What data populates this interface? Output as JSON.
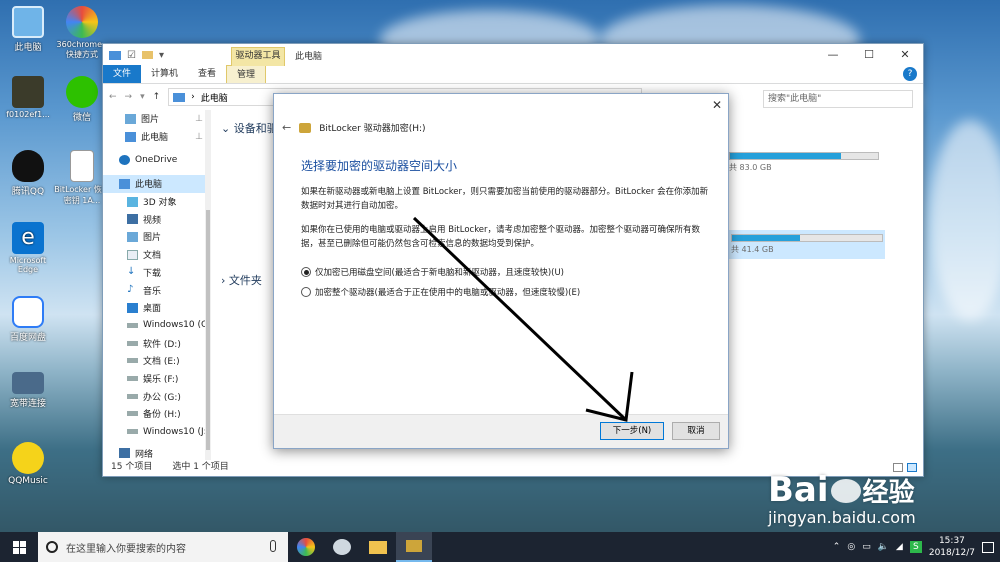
{
  "desktop_icons": [
    {
      "label": "此电脑"
    },
    {
      "label": "360chrome - 快捷方式"
    },
    {
      "label": "f0102ef1..."
    },
    {
      "label": "微信"
    },
    {
      "label": "腾讯QQ"
    },
    {
      "label": "BitLocker 恢复密钥 1A..."
    },
    {
      "label": "Microsoft Edge"
    },
    {
      "label": "百度网盘"
    },
    {
      "label": "宽带连接"
    },
    {
      "label": "QQMusic"
    }
  ],
  "explorer": {
    "context_tab_group": "驱动器工具",
    "window_title": "此电脑",
    "controls": {
      "minimize": "—",
      "maximize": "☐",
      "close": "✕"
    },
    "ribbon_tabs": [
      "文件",
      "计算机",
      "查看",
      "管理"
    ],
    "address": "此电脑",
    "search_placeholder": "搜索\"此电脑\"",
    "nav_items": [
      {
        "label": "图片",
        "icon": "pictures-icon"
      },
      {
        "label": "此电脑",
        "icon": "computer-icon"
      },
      {
        "label": "OneDrive",
        "icon": "onedrive-icon"
      },
      {
        "label": "此电脑",
        "icon": "computer-icon"
      },
      {
        "label": "3D 对象",
        "icon": "3d-objects-icon"
      },
      {
        "label": "视频",
        "icon": "video-icon"
      },
      {
        "label": "图片",
        "icon": "pictures-icon"
      },
      {
        "label": "文档",
        "icon": "documents-icon"
      },
      {
        "label": "下载",
        "icon": "download-icon"
      },
      {
        "label": "音乐",
        "icon": "music-icon"
      },
      {
        "label": "桌面",
        "icon": "desktop-icon"
      },
      {
        "label": "Windows10 (C:",
        "icon": "drive-icon"
      },
      {
        "label": "软件 (D:)",
        "icon": "drive-icon"
      },
      {
        "label": "文档 (E:)",
        "icon": "drive-icon"
      },
      {
        "label": "娱乐 (F:)",
        "icon": "drive-icon"
      },
      {
        "label": "办公 (G:)",
        "icon": "drive-icon"
      },
      {
        "label": "备份 (H:)",
        "icon": "drive-icon"
      },
      {
        "label": "Windows10 (J:)",
        "icon": "drive-icon"
      },
      {
        "label": "网络",
        "icon": "network-icon"
      }
    ],
    "groups": {
      "devices": "设备和驱",
      "folders": "文件夹"
    },
    "drives": [
      {
        "free_text": "共 83.0 GB",
        "used_fraction": 0.75
      },
      {
        "free_text": "共 41.4 GB",
        "used_fraction": 0.45
      }
    ],
    "status": {
      "count": "15 个项目",
      "selected": "选中 1 个项目"
    }
  },
  "dialog": {
    "window_title": "BitLocker 驱动器加密(H:)",
    "heading": "选择要加密的驱动器空间大小",
    "para1": "如果在新驱动器或新电脑上设置 BitLocker，则只需要加密当前使用的驱动器部分。BitLocker 会在你添加新数据时对其进行自动加密。",
    "para2": "如果你在已使用的电脑或驱动器上启用 BitLocker，请考虑加密整个驱动器。加密整个驱动器可确保所有数据，甚至已删除但可能仍然包含可检索信息的数据均受到保护。",
    "options": [
      {
        "label": "仅加密已用磁盘空间(最适合于新电脑和新驱动器，且速度较快)(U)",
        "selected": true
      },
      {
        "label": "加密整个驱动器(最适合于正在使用中的电脑或驱动器，但速度较慢)(E)",
        "selected": false
      }
    ],
    "next_button": "下一步(N)",
    "cancel_button": "取消"
  },
  "taskbar": {
    "search_placeholder": "在这里输入你要搜索的内容",
    "time": "15:37",
    "date": "2018/12/7"
  },
  "watermark": {
    "brand": "Bai",
    "brand2": "经验",
    "url": "jingyan.baidu.com"
  },
  "colors": {
    "accent": "#1979ca",
    "dialog_heading": "#1b4fa0",
    "drive_bar": "#26a0da"
  }
}
